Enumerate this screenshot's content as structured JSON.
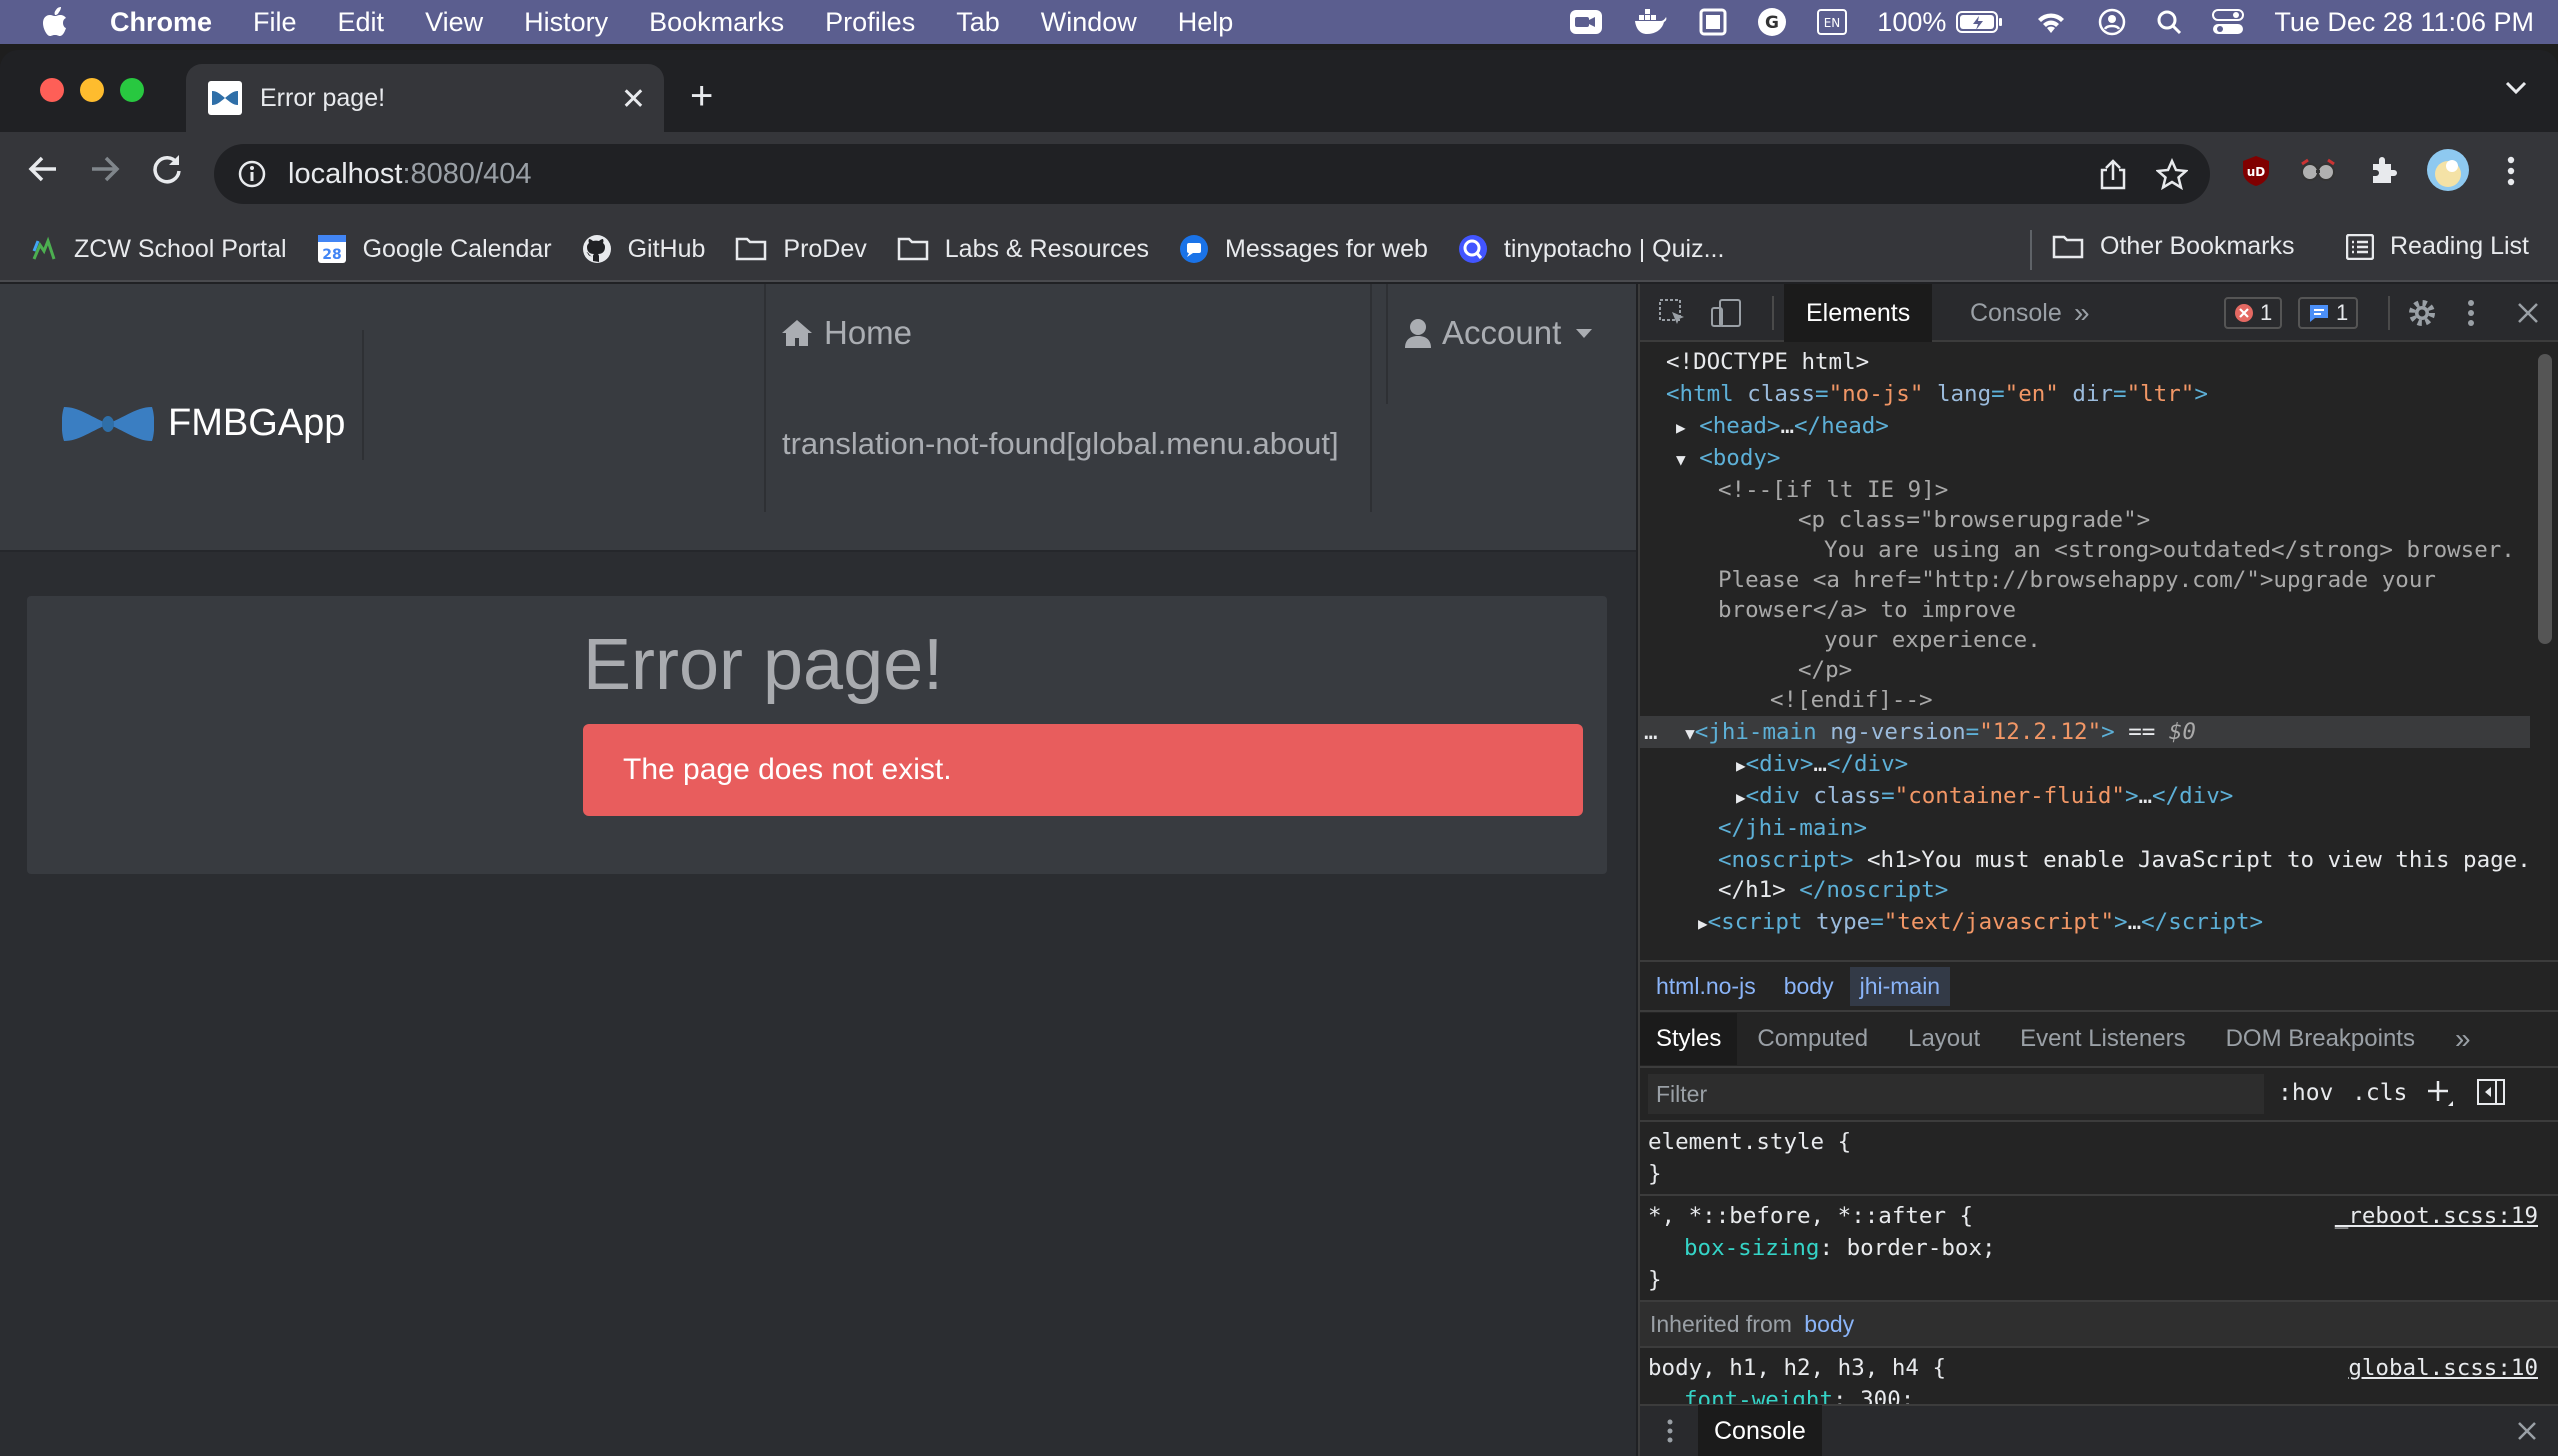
{
  "menubar": {
    "app_name": "Chrome",
    "items": [
      "File",
      "Edit",
      "View",
      "History",
      "Bookmarks",
      "Profiles",
      "Tab",
      "Window",
      "Help"
    ],
    "battery": "100%",
    "clock": "Tue Dec 28  11:06 PM"
  },
  "browser": {
    "tab_title": "Error page!",
    "url_host": "localhost",
    "url_rest": ":8080/404",
    "bookmarks": [
      "ZCW School Portal",
      "Google Calendar",
      "GitHub",
      "ProDev",
      "Labs & Resources",
      "Messages for web",
      "tinypotacho | Quiz..."
    ],
    "other_bookmarks": "Other Bookmarks",
    "reading_list": "Reading List"
  },
  "app": {
    "brand": "FMBGApp",
    "nav_home": "Home",
    "nav_about": "translation-not-found[global.menu.about]",
    "nav_account": "Account",
    "error_title": "Error page!",
    "error_message": "The page does not exist."
  },
  "devtools": {
    "tabs": [
      "Elements",
      "Console"
    ],
    "error_count": "1",
    "message_count": "1",
    "breadcrumbs": [
      "html.no-js",
      "body",
      "jhi-main"
    ],
    "style_tabs": [
      "Styles",
      "Computed",
      "Layout",
      "Event Listeners",
      "DOM Breakpoints"
    ],
    "filter_placeholder": "Filter",
    "hov": ":hov",
    "cls": ".cls",
    "rule1_selector": "element.style {",
    "rule2_selector": "*, *::before, *::after {",
    "rule2_prop": "box-sizing",
    "rule2_val": "border-box;",
    "rule2_source": "_reboot.scss:19",
    "inherited_label": "Inherited from",
    "inherited_from": "body",
    "rule3_selector": "body, h1, h2, h3, h4 {",
    "rule3_prop": "font-weight",
    "rule3_val": "300;",
    "rule3_source": "global.scss:10",
    "drawer_tab": "Console"
  }
}
